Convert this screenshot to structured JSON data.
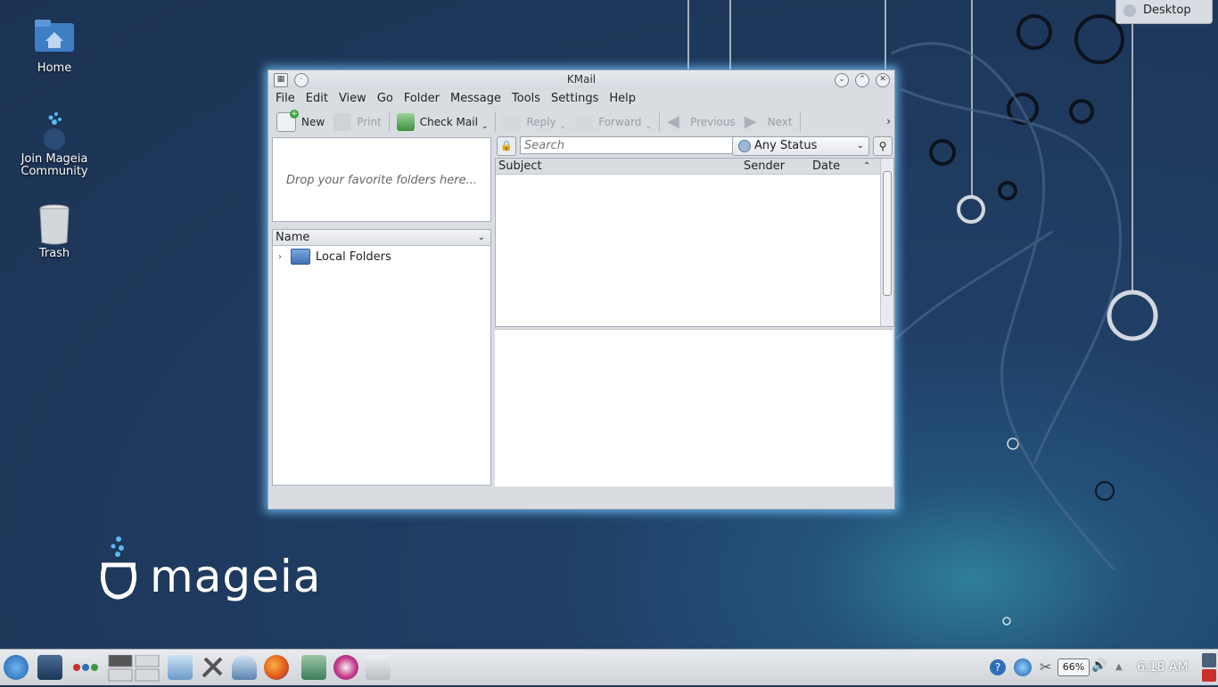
{
  "desktop": {
    "icons": [
      {
        "label": "Home"
      },
      {
        "label": "Join Mageia Community"
      },
      {
        "label": "Trash"
      }
    ],
    "activity_tab": "Desktop",
    "logo_text": "mageia"
  },
  "window": {
    "title": "KMail",
    "menu": [
      "File",
      "Edit",
      "View",
      "Go",
      "Folder",
      "Message",
      "Tools",
      "Settings",
      "Help"
    ],
    "toolbar": {
      "new": "New",
      "print": "Print",
      "check_mail": "Check Mail",
      "reply": "Reply",
      "forward": "Forward",
      "previous": "Previous",
      "next": "Next"
    },
    "favorites_hint": "Drop your favorite folders here...",
    "folder_header": "Name",
    "folders": [
      "Local Folders"
    ],
    "search": {
      "placeholder": "Search"
    },
    "status_filter": "Any Status",
    "columns": {
      "subject": "Subject",
      "sender": "Sender",
      "date": "Date"
    }
  },
  "taskbar": {
    "battery": "66%",
    "clock": "6:18 AM"
  },
  "colors": {
    "accent": "#3f72b8",
    "wallpaper": "#1f3a5e",
    "window_glow": "#78c8ff"
  }
}
